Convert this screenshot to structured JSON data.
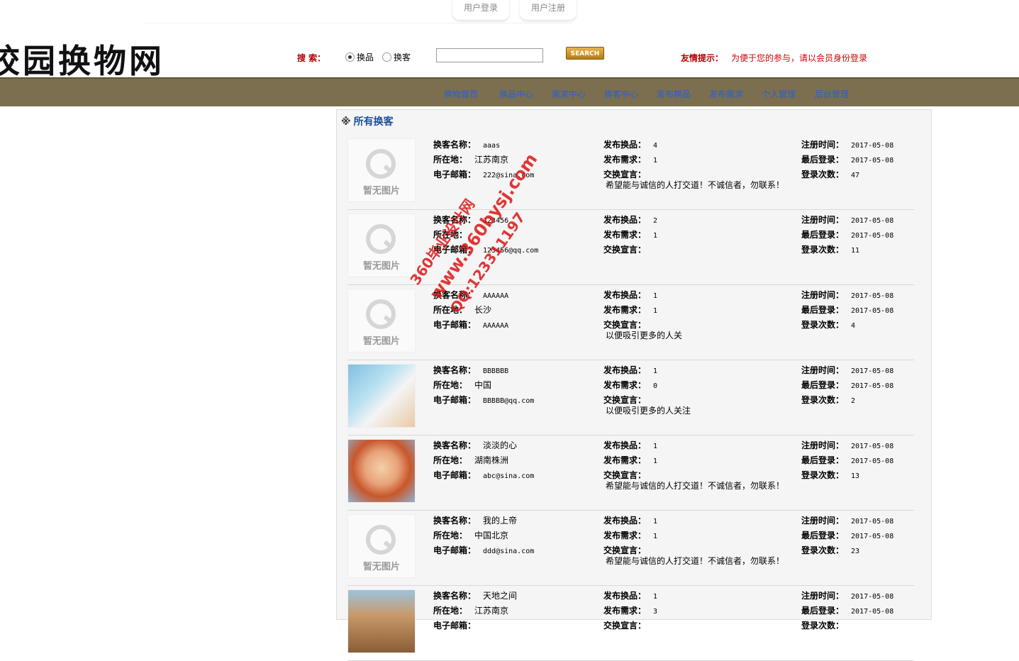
{
  "top_links": {
    "login": "用户登录",
    "register": "用户注册"
  },
  "logo": "校园换物网",
  "search": {
    "label": "搜  索：",
    "option_goods": "换品",
    "option_user": "换客",
    "selected": "换品",
    "value": "",
    "button": "SEARCH"
  },
  "tip": {
    "label": "友情提示：",
    "text": "为便于您的参与，请以会员身份登录"
  },
  "nav": [
    "换物首页",
    "换品中心",
    "需求中心",
    "换客中心",
    "发布换品",
    "发布需求",
    "个人管理",
    "后台管理"
  ],
  "panel": {
    "mark": "※",
    "title": "所有换客"
  },
  "labels": {
    "name": "换客名称：",
    "location": "所在地：",
    "email": "电子邮箱：",
    "goods": "发布换品：",
    "needs": "发布需求：",
    "motto": "交换宣言：",
    "reg": "注册时间：",
    "last": "最后登录：",
    "count": "登录次数：",
    "noimg": "暂无图片"
  },
  "users": [
    {
      "name": "aaas",
      "location": "江苏南京",
      "email": "222@sina.com",
      "goods": "4",
      "needs": "1",
      "motto": "希望能与诚信的人打交道！不诚信者，勿联系！",
      "reg": "2017-05-08",
      "last": "2017-05-08",
      "count": "47",
      "avatar": "none"
    },
    {
      "name": "123456",
      "location": "",
      "email": "123456@qq.com",
      "goods": "2",
      "needs": "1",
      "motto": "",
      "reg": "2017-05-08",
      "last": "2017-05-08",
      "count": "11",
      "avatar": "none"
    },
    {
      "name": "AAAAAA",
      "location": "长沙",
      "email": "AAAAAA",
      "goods": "1",
      "needs": "1",
      "motto": "以便吸引更多的人关",
      "reg": "2017-05-08",
      "last": "2017-05-08",
      "count": "4",
      "avatar": "none"
    },
    {
      "name": "BBBBBB",
      "location": "中国",
      "email": "BBBBB@qq.com",
      "goods": "1",
      "needs": "0",
      "motto": "以便吸引更多的人关注",
      "reg": "2017-05-08",
      "last": "2017-05-08",
      "count": "2",
      "avatar": "cartoon"
    },
    {
      "name": "淡淡的心",
      "location": "湖南株洲",
      "email": "abc@sina.com",
      "goods": "1",
      "needs": "1",
      "motto": "希望能与诚信的人打交道！不诚信者，勿联系！",
      "reg": "2017-05-08",
      "last": "2017-05-08",
      "count": "13",
      "avatar": "child"
    },
    {
      "name": "我的上帝",
      "location": "中国北京",
      "email": "ddd@sina.com",
      "goods": "1",
      "needs": "1",
      "motto": "希望能与诚信的人打交道！不诚信者，勿联系！",
      "reg": "2017-05-08",
      "last": "2017-05-08",
      "count": "23",
      "avatar": "none"
    },
    {
      "name": "天地之间",
      "location": "江苏南京",
      "email": "",
      "goods": "1",
      "needs": "3",
      "motto": "",
      "reg": "2017-05-08",
      "last": "2017-05-08",
      "count": "",
      "avatar": "dog"
    }
  ],
  "watermark": {
    "line1": "360毕业设计网",
    "line2": "www.360bysj.com",
    "line3": "QQ:123311197"
  }
}
